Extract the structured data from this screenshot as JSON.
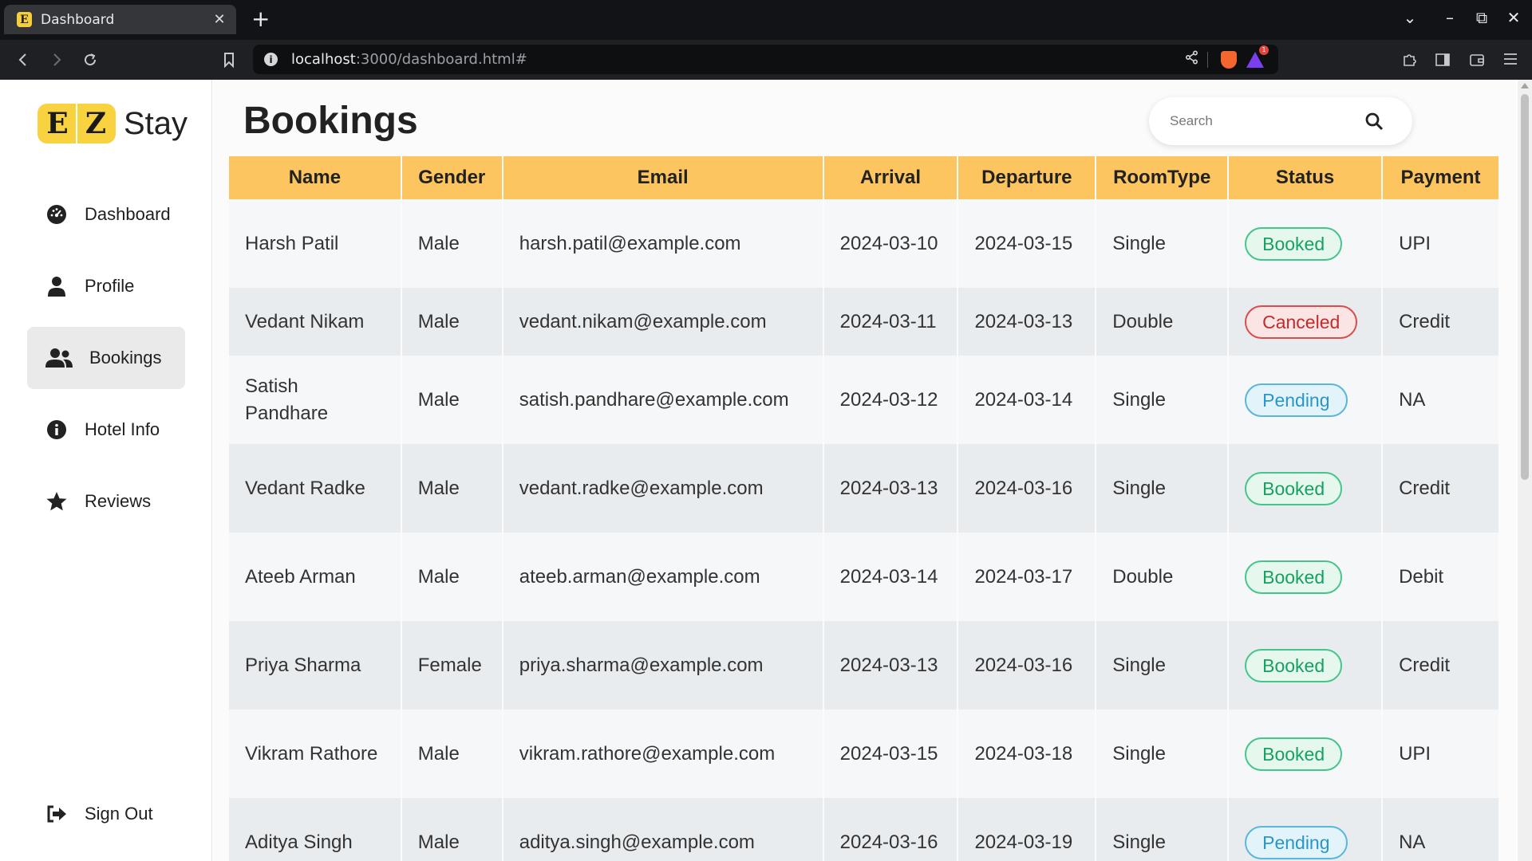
{
  "browser": {
    "tab_title": "Dashboard",
    "tab_favicon": "E",
    "url_host": "localhost",
    "url_rest": ":3000/dashboard.html#",
    "rewards_badge": "1"
  },
  "logo": {
    "letter1": "E",
    "letter2": "Z",
    "word": "Stay",
    "brand_color": "#f9d23f"
  },
  "sidebar": {
    "items": [
      {
        "label": "Dashboard",
        "icon": "gauge-icon"
      },
      {
        "label": "Profile",
        "icon": "user-icon"
      },
      {
        "label": "Bookings",
        "icon": "users-icon",
        "active": true
      },
      {
        "label": "Hotel Info",
        "icon": "info-icon"
      },
      {
        "label": "Reviews",
        "icon": "star-icon"
      }
    ],
    "signout": {
      "label": "Sign Out",
      "icon": "sign-out-icon"
    }
  },
  "main": {
    "title": "Bookings",
    "search": {
      "placeholder": "Search",
      "value": ""
    }
  },
  "table": {
    "header_color": "#fcc55f",
    "columns": [
      "Name",
      "Gender",
      "Email",
      "Arrival",
      "Departure",
      "RoomType",
      "Status",
      "Payment"
    ],
    "rows": [
      {
        "name": "Harsh Patil",
        "gender": "Male",
        "email": "harsh.patil@example.com",
        "arrival": "2024-03-10",
        "departure": "2024-03-15",
        "roomtype": "Single",
        "status": "Booked",
        "payment": "UPI"
      },
      {
        "name": "Vedant Nikam",
        "gender": "Male",
        "email": "vedant.nikam@example.com",
        "arrival": "2024-03-11",
        "departure": "2024-03-13",
        "roomtype": "Double",
        "status": "Canceled",
        "payment": "Credit"
      },
      {
        "name": "Satish Pandhare",
        "gender": "Male",
        "email": "satish.pandhare@example.com",
        "arrival": "2024-03-12",
        "departure": "2024-03-14",
        "roomtype": "Single",
        "status": "Pending",
        "payment": "NA"
      },
      {
        "name": "Vedant Radke",
        "gender": "Male",
        "email": "vedant.radke@example.com",
        "arrival": "2024-03-13",
        "departure": "2024-03-16",
        "roomtype": "Single",
        "status": "Booked",
        "payment": "Credit"
      },
      {
        "name": "Ateeb Arman",
        "gender": "Male",
        "email": "ateeb.arman@example.com",
        "arrival": "2024-03-14",
        "departure": "2024-03-17",
        "roomtype": "Double",
        "status": "Booked",
        "payment": "Debit"
      },
      {
        "name": "Priya Sharma",
        "gender": "Female",
        "email": "priya.sharma@example.com",
        "arrival": "2024-03-13",
        "departure": "2024-03-16",
        "roomtype": "Single",
        "status": "Booked",
        "payment": "Credit"
      },
      {
        "name": "Vikram Rathore",
        "gender": "Male",
        "email": "vikram.rathore@example.com",
        "arrival": "2024-03-15",
        "departure": "2024-03-18",
        "roomtype": "Single",
        "status": "Booked",
        "payment": "UPI"
      },
      {
        "name": "Aditya Singh",
        "gender": "Male",
        "email": "aditya.singh@example.com",
        "arrival": "2024-03-16",
        "departure": "2024-03-19",
        "roomtype": "Single",
        "status": "Pending",
        "payment": "NA"
      }
    ]
  }
}
